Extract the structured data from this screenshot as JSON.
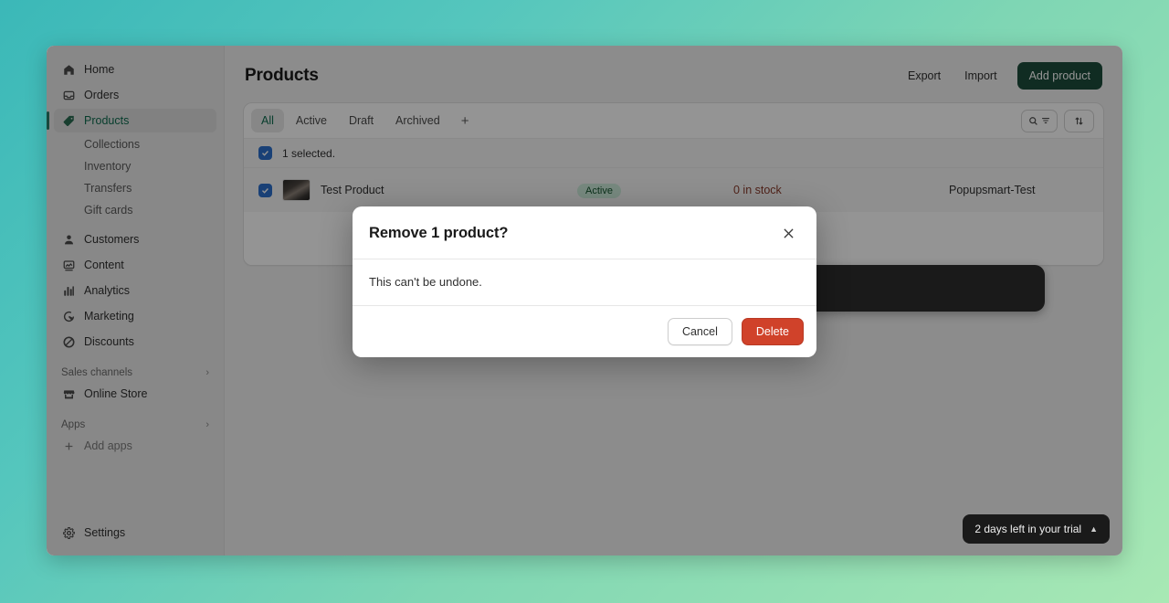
{
  "sidebar": {
    "items": [
      {
        "label": "Home",
        "icon": "home-icon",
        "active": false
      },
      {
        "label": "Orders",
        "icon": "orders-icon",
        "active": false
      },
      {
        "label": "Products",
        "icon": "tag-icon",
        "active": true
      }
    ],
    "sub_items": [
      {
        "label": "Collections"
      },
      {
        "label": "Inventory"
      },
      {
        "label": "Transfers"
      },
      {
        "label": "Gift cards"
      }
    ],
    "items2": [
      {
        "label": "Customers",
        "icon": "person-icon"
      },
      {
        "label": "Content",
        "icon": "content-icon"
      },
      {
        "label": "Analytics",
        "icon": "analytics-icon"
      },
      {
        "label": "Marketing",
        "icon": "marketing-icon"
      },
      {
        "label": "Discounts",
        "icon": "discount-icon"
      }
    ],
    "sales_channels_label": "Sales channels",
    "online_store_label": "Online Store",
    "apps_label": "Apps",
    "add_apps_label": "Add apps",
    "settings_label": "Settings"
  },
  "header": {
    "title": "Products",
    "export_label": "Export",
    "import_label": "Import",
    "add_product_label": "Add product"
  },
  "tabs": [
    {
      "label": "All",
      "selected": true
    },
    {
      "label": "Active",
      "selected": false
    },
    {
      "label": "Draft",
      "selected": false
    },
    {
      "label": "Archived",
      "selected": false
    }
  ],
  "tab_add_label": "+",
  "table": {
    "selected_text": "1 selected.",
    "row": {
      "name": "Test Product",
      "status": "Active",
      "stock": "0 in stock",
      "vendor": "Popupsmart-Test"
    }
  },
  "trial": {
    "text": "2 days left in your trial",
    "caret": "▲"
  },
  "modal": {
    "title": "Remove 1 product?",
    "body": "This can't be undone.",
    "cancel_label": "Cancel",
    "delete_label": "Delete"
  },
  "colors": {
    "primary_green": "#1d4d3b",
    "danger_red": "#d0422a",
    "checkbox_blue": "#2c6ecb",
    "badge_green": "#cdeddb",
    "stock_warning": "#8a3b2b"
  }
}
